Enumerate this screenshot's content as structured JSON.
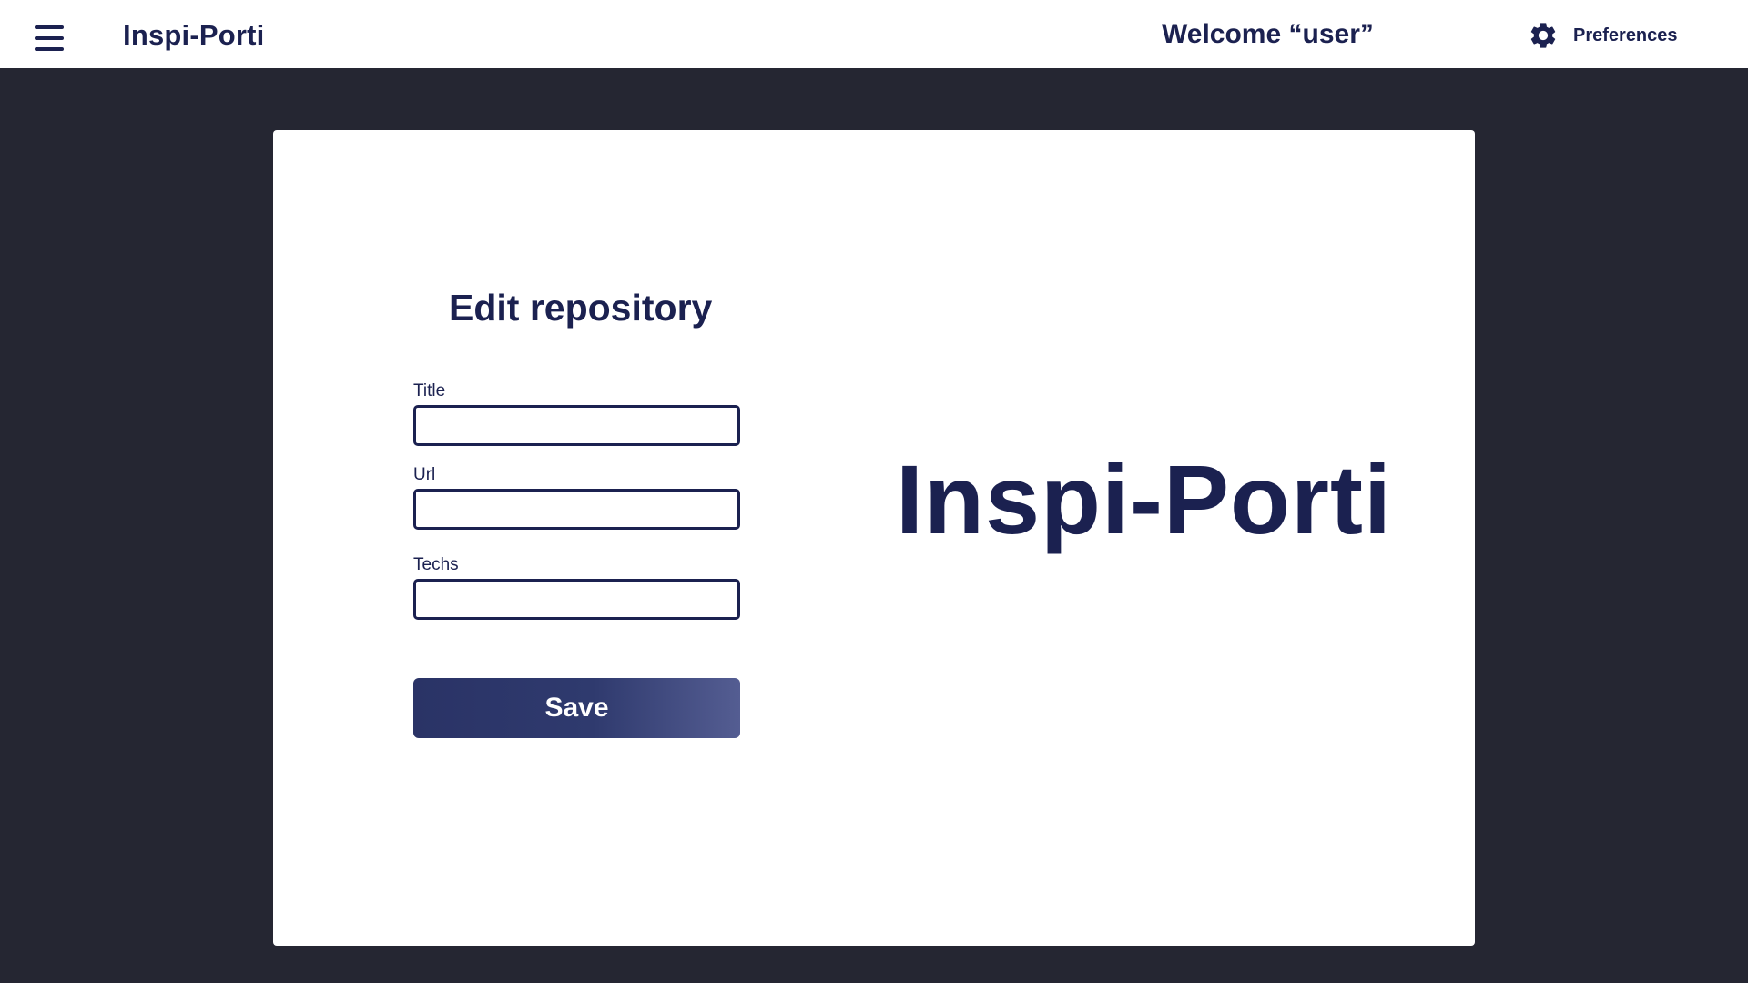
{
  "header": {
    "menu_icon": "hamburger-menu-icon",
    "brand": "Inspi-Porti",
    "welcome": "Welcome “user”",
    "preferences_icon": "gear-icon",
    "preferences_label": "Preferences"
  },
  "form": {
    "title": "Edit repository",
    "fields": [
      {
        "label": "Title",
        "value": "",
        "placeholder": ""
      },
      {
        "label": "Url",
        "value": "",
        "placeholder": ""
      },
      {
        "label": "Techs",
        "value": "",
        "placeholder": ""
      }
    ],
    "save_label": "Save"
  },
  "logo": {
    "text": "Inspi-Porti"
  },
  "colors": {
    "background": "#252632",
    "primary": "#1b2150",
    "card": "#ffffff",
    "button_gradient_start": "#2a3366",
    "button_gradient_end": "#545d92"
  }
}
